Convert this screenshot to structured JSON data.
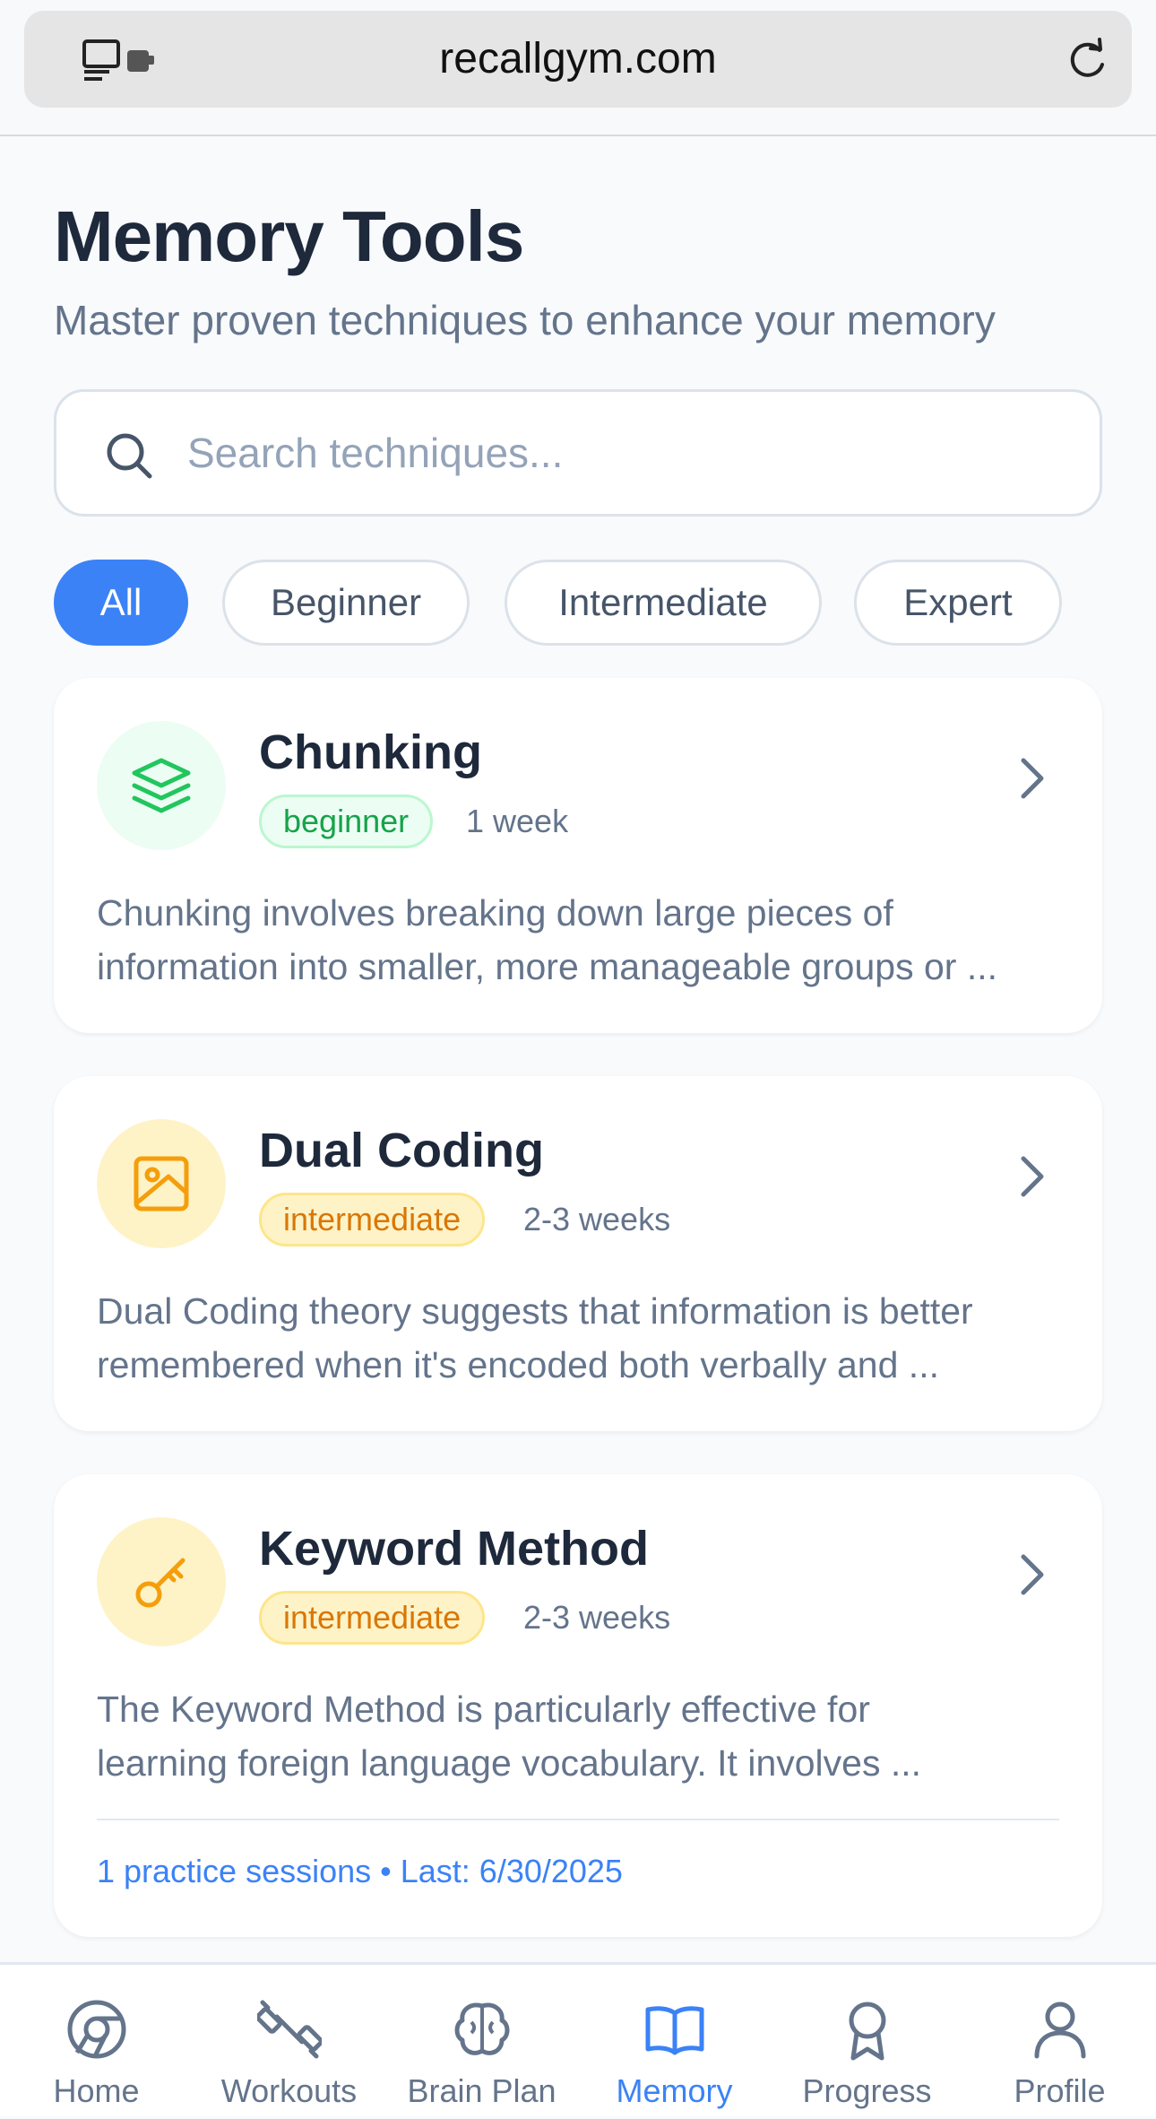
{
  "browser": {
    "url": "recallgym.com",
    "icons": [
      "tab-overview-icon",
      "extension-icon",
      "reload-icon"
    ]
  },
  "header": {
    "title": "Memory Tools",
    "subtitle": "Master proven techniques to enhance your memory"
  },
  "search": {
    "placeholder": "Search techniques...",
    "value": ""
  },
  "filters": [
    {
      "label": "All",
      "active": true
    },
    {
      "label": "Beginner",
      "active": false
    },
    {
      "label": "Intermediate",
      "active": false
    },
    {
      "label": "Expert",
      "active": false
    }
  ],
  "techniques": [
    {
      "title": "Chunking",
      "icon": "layers-icon",
      "level": "beginner",
      "duration": "1 week",
      "desc_line1": "Chunking involves breaking down large pieces of",
      "desc_line2": "information into smaller, more manageable groups or ..."
    },
    {
      "title": "Dual Coding",
      "icon": "image-icon",
      "level": "intermediate",
      "duration": "2-3 weeks",
      "desc_line1": "Dual Coding theory suggests that information is better",
      "desc_line2": "remembered when it's encoded both verbally and ..."
    },
    {
      "title": "Keyword Method",
      "icon": "key-icon",
      "level": "intermediate",
      "duration": "2-3 weeks",
      "desc_line1": "The Keyword Method is particularly effective for",
      "desc_line2": "learning foreign language vocabulary. It involves ...",
      "practice_meta": "1 practice sessions • Last: 6/30/2025"
    }
  ],
  "colors": {
    "accent": "#3b82f6",
    "beginner": "#16a34a",
    "intermediate": "#d97706",
    "text_dark": "#1e293b",
    "text_muted": "#64748b"
  },
  "nav": [
    {
      "label": "Home",
      "icon": "home-icon",
      "active": false
    },
    {
      "label": "Workouts",
      "icon": "dumbbell-icon",
      "active": false
    },
    {
      "label": "Brain Plan",
      "icon": "brain-icon",
      "active": false
    },
    {
      "label": "Memory",
      "icon": "book-icon",
      "active": true
    },
    {
      "label": "Progress",
      "icon": "award-icon",
      "active": false
    },
    {
      "label": "Profile",
      "icon": "user-icon",
      "active": false
    }
  ]
}
